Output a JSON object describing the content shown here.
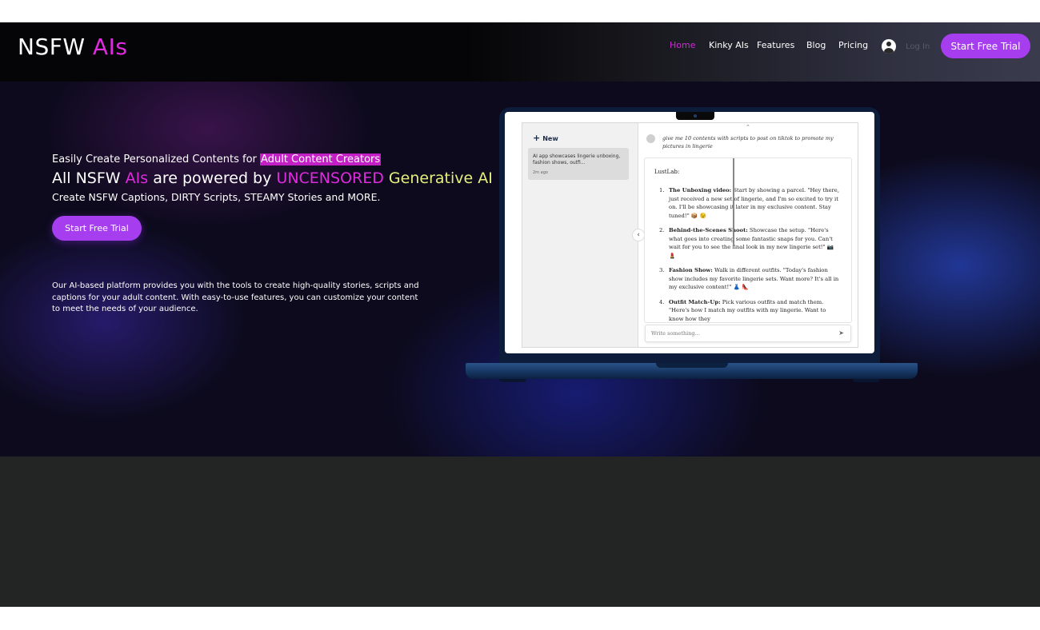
{
  "header": {
    "logo": {
      "text": "NSFW",
      "accent": "AIs"
    },
    "nav": [
      {
        "label": "Home",
        "active": true
      },
      {
        "label": "Kinky AIs",
        "active": false
      },
      {
        "label": "Features",
        "active": false
      },
      {
        "label": "Blog",
        "active": false
      },
      {
        "label": "Pricing",
        "active": false
      }
    ],
    "login_label": "Log In",
    "cta_label": "Start Free Trial"
  },
  "hero": {
    "eyebrow_prefix": "Easily Create Personalized Contents for",
    "eyebrow_highlight": "Adult Content Creators",
    "headline": {
      "part1": "All NSFW",
      "part2": "AIs",
      "part3": "are powered by",
      "part4": "UNCENSORED",
      "part5": "Generative AI"
    },
    "subline": "Create NSFW Captions, DIRTY Scripts, STEAMY Stories and MORE.",
    "cta_label": "Start Free Trial",
    "description": "Our AI-based platform provides you with the tools to create high-quality stories, scripts and captions for your adult content. With easy-to-use features, you can customize your content to meet the needs of your audience."
  },
  "app": {
    "new_label": "New",
    "session": {
      "title": "AI app showcases lingerie unboxing, fashion shows, outfi...",
      "time": "2m ago"
    },
    "user_message": "give me 10 contents with scripts to post on tiktok to promote my pictures in lingerie",
    "bot_name": "LustLab:",
    "items": [
      {
        "num": "1.",
        "title": "The Unboxing video:",
        "text": "Start by showing a parcel. \"Hey there, just received a new set of lingerie, and I'm so excited to try it on. I'll be showcasing it later in my exclusive content. Stay tuned!\" 📦 😉"
      },
      {
        "num": "2.",
        "title": "Behind-the-Scenes Shoot:",
        "text": "Showcase the setup. \"Here's what goes into creating some fantastic snaps for you. Can't wait for you to see the final look in my new lingerie set!\" 📷 💄"
      },
      {
        "num": "3.",
        "title": "Fashion Show:",
        "text": "Walk in different outfits. \"Today's fashion show includes my favorite lingerie sets. Want more? It's all in my exclusive content!\" 👗 👠"
      },
      {
        "num": "4.",
        "title": "Outfit Match-Up:",
        "text": "Pick various outfits and match them. \"Here's how I match my outfits with my lingerie. Want to know how they"
      }
    ],
    "input_placeholder": "Write something..."
  },
  "colors": {
    "accent_pink": "#e02adf",
    "cta_purple": "#a63ef0",
    "highlight_yellow": "#e6ef7b",
    "footer_band": "#232424"
  }
}
